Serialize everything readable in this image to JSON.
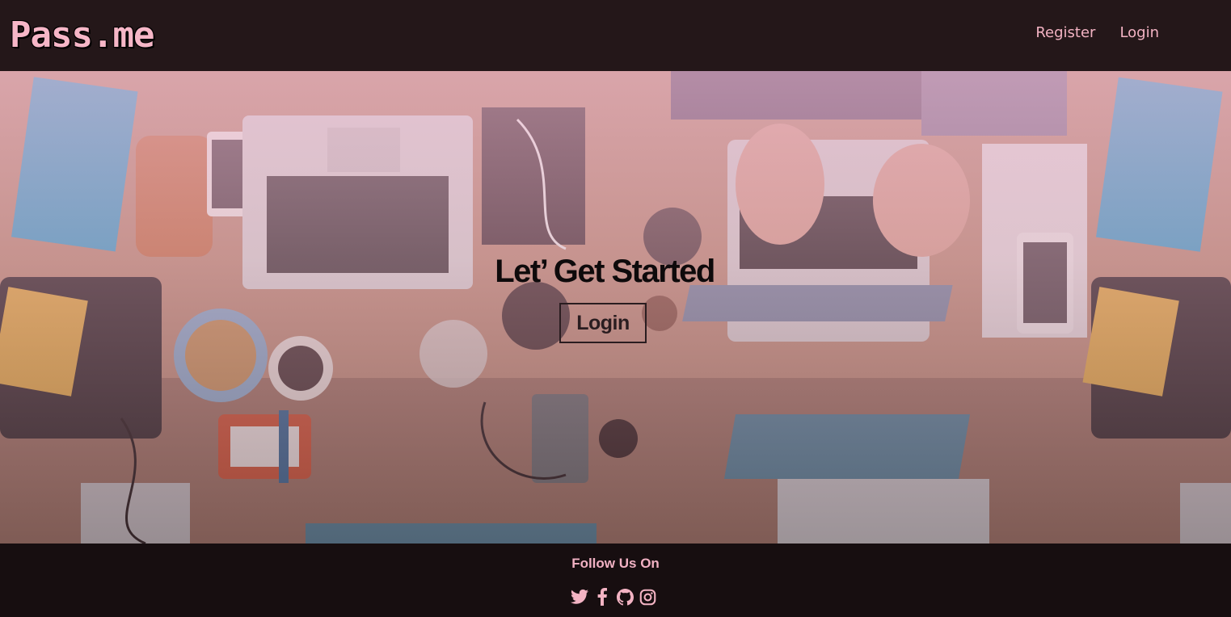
{
  "header": {
    "logo": "Pass.me",
    "nav": {
      "register_label": "Register",
      "login_label": "Login"
    }
  },
  "hero": {
    "title": "Let’ Get Started",
    "login_button_label": "Login",
    "background_image": "desk-with-laptops-photo"
  },
  "footer": {
    "follow_label": "Follow Us On",
    "social_icons": [
      "twitter-icon",
      "facebook-icon",
      "github-icon",
      "instagram-icon"
    ]
  },
  "colors": {
    "header_bg": "#241719",
    "footer_bg": "#170e10",
    "accent_pink": "#f3b3c3",
    "hero_text": "#0e0a0b"
  }
}
